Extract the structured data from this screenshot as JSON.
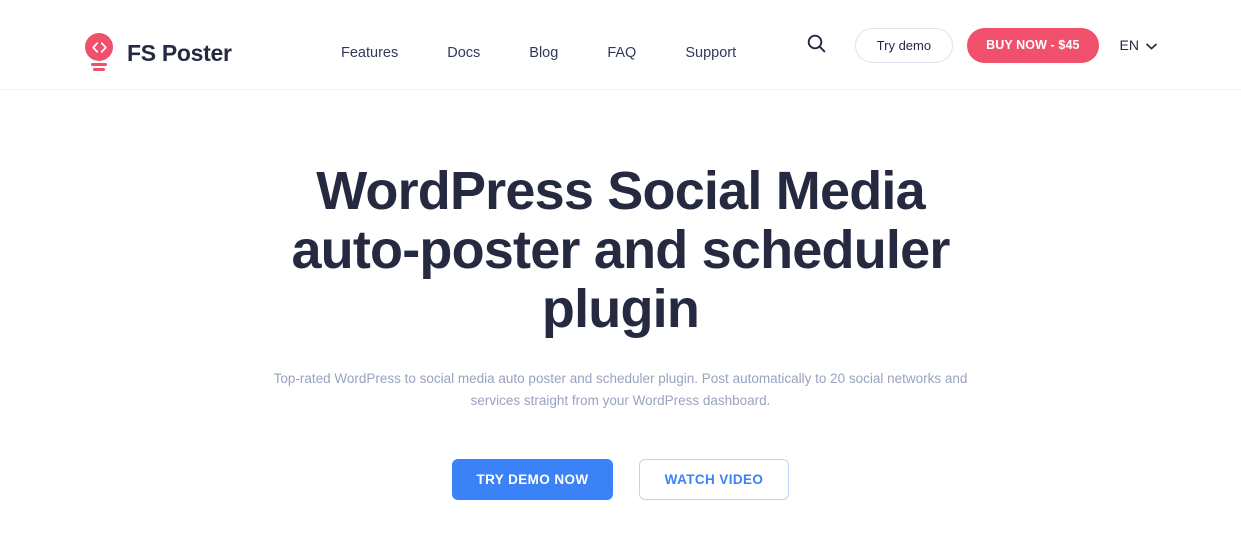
{
  "header": {
    "brand": {
      "name": "FS Poster",
      "logo_icon": "code-bulb-icon",
      "accent_color": "#F0506B"
    },
    "nav": [
      {
        "label": "Features"
      },
      {
        "label": "Docs"
      },
      {
        "label": "Blog"
      },
      {
        "label": "FAQ"
      },
      {
        "label": "Support"
      }
    ],
    "actions": {
      "search_icon": "search-icon",
      "try_demo_label": "Try demo",
      "buy_now_label": "BUY NOW - $45",
      "buy_now_color": "#F0506B",
      "language": "EN",
      "language_chevron_icon": "chevron-down-icon"
    }
  },
  "hero": {
    "title": "WordPress Social Media auto-poster and scheduler plugin",
    "subtitle": "Top-rated WordPress to social media auto poster and scheduler plugin. Post automatically to 20 social networks and services straight from your WordPress dashboard.",
    "primary_cta": "TRY DEMO NOW",
    "secondary_cta": "WATCH VIDEO",
    "primary_color": "#3B82F6",
    "title_color": "#252A41",
    "subtitle_color": "#9AA2BF"
  }
}
